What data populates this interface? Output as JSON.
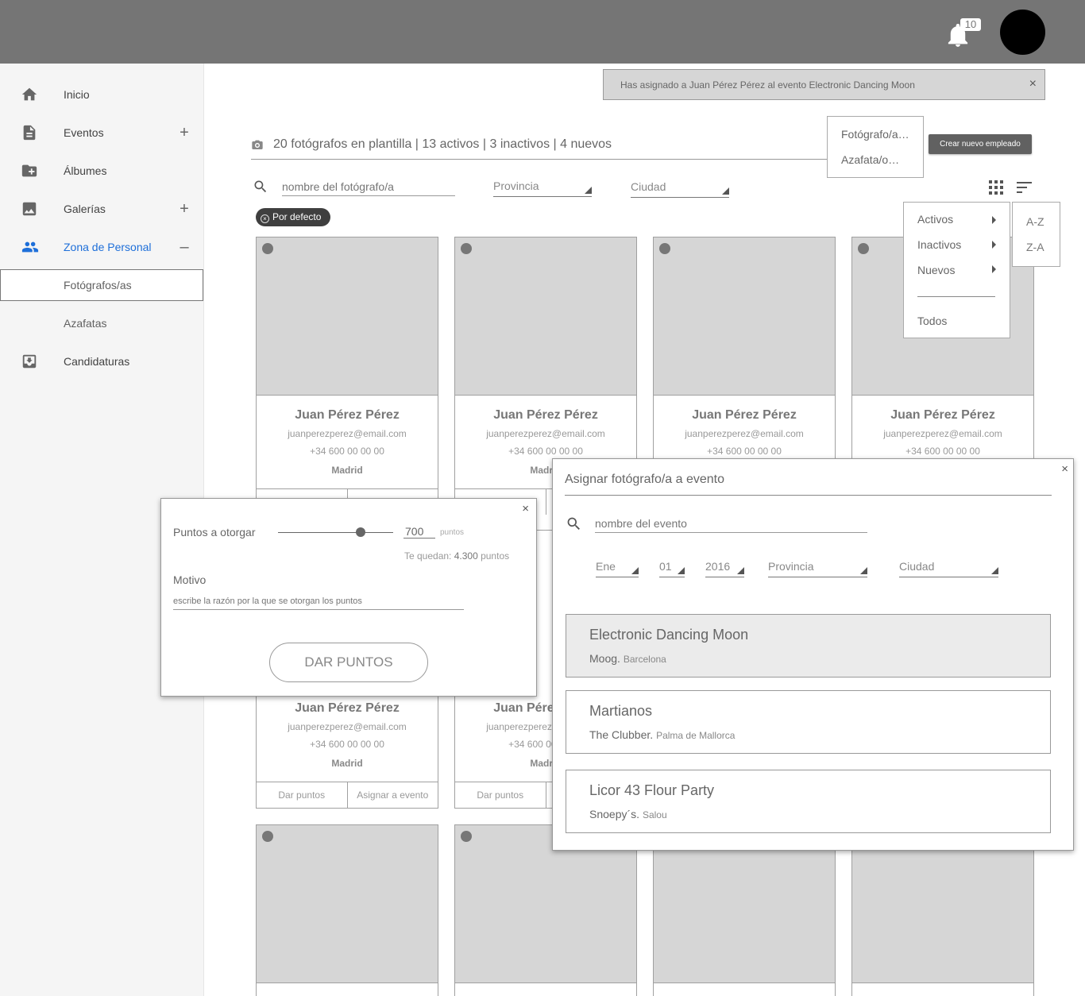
{
  "topbar": {
    "notification_count": "10"
  },
  "sidebar": {
    "items": [
      {
        "label": "Inicio",
        "icon": "home-icon"
      },
      {
        "label": "Eventos",
        "icon": "document-icon",
        "toggle": "+"
      },
      {
        "label": "Álbumes",
        "icon": "folder-add-icon"
      },
      {
        "label": "Galerías",
        "icon": "image-icon",
        "toggle": "+"
      },
      {
        "label": "Zona de Personal",
        "icon": "people-icon",
        "toggle": "–"
      },
      {
        "label": "Candidaturas",
        "icon": "inbox-icon"
      }
    ],
    "subitems": [
      {
        "label": "Fotógrafos/as"
      },
      {
        "label": "Azafatas"
      }
    ],
    "accent_color": "#1e6fd9"
  },
  "notification": {
    "text": "Has asignado a Juan Pérez Pérez al evento Electronic Dancing Moon",
    "close": "×"
  },
  "header": {
    "stats": "20 fotógrafos en plantilla | 13 activos | 3 inactivos | 4 nuevos",
    "type_menu": [
      "Fotógrafo/a…",
      "Azafata/o…"
    ],
    "create_button": "Crear nuevo empleado"
  },
  "filters": {
    "search_placeholder": "nombre del fotógrafo/a",
    "province": "Provincia",
    "city": "Ciudad",
    "chip": "Por defecto"
  },
  "status_menu": {
    "items": [
      "Activos",
      "Inactivos",
      "Nuevos"
    ],
    "all": "Todos"
  },
  "sort_menu": {
    "items": [
      "A-Z",
      "Z-A"
    ]
  },
  "card": {
    "name": "Juan Pérez Pérez",
    "email": "juanperezperez@email.com",
    "phone": "+34 600 00 00 00",
    "city": "Madrid",
    "action_points": "Dar puntos",
    "action_assign": "Asignar a evento"
  },
  "puntos_modal": {
    "label": "Puntos a otorgar",
    "value": "700",
    "unit": "puntos",
    "remaining_prefix": "Te quedan: ",
    "remaining_value": "4.300",
    "remaining_suffix": " puntos",
    "slider_level": 0.72,
    "motivo_label": "Motivo",
    "motivo_placeholder": "escribe la razón por la que se otorgan los puntos",
    "button": "DAR PUNTOS",
    "close": "×"
  },
  "asignar_modal": {
    "title": "Asignar fotógrafo/a a evento",
    "search_placeholder": "nombre del evento",
    "month": "Ene",
    "day": "01",
    "year": "2016",
    "province": "Provincia",
    "city": "Ciudad",
    "close": "×",
    "events": [
      {
        "name": "Electronic Dancing Moon",
        "venue": "Moog",
        "city": "Barcelona"
      },
      {
        "name": "Martianos",
        "venue": "The Clubber",
        "city": "Palma de Mallorca"
      },
      {
        "name": "Licor 43 Flour Party",
        "venue": "Snoepy´s",
        "city": "Salou"
      }
    ]
  }
}
